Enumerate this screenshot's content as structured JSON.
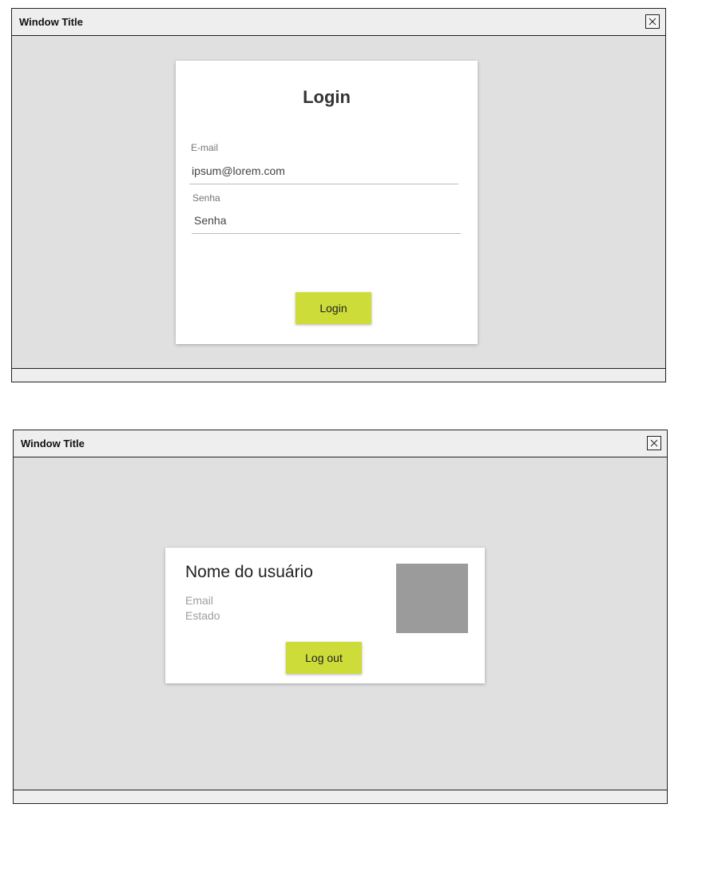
{
  "login_window": {
    "title": "Window Title",
    "card": {
      "heading": "Login",
      "email_label": "E-mail",
      "email_value": "ipsum@lorem.com",
      "password_label": "Senha",
      "password_placeholder": "Senha",
      "login_button": "Login"
    }
  },
  "profile_window": {
    "title": "Window Title",
    "card": {
      "user_name": "Nome do usuário",
      "email": "Email",
      "state": "Estado",
      "logout_button": "Log out"
    }
  },
  "icons": {
    "close": "close-icon"
  },
  "colors": {
    "accent_button": "#cddc39",
    "avatar_placeholder": "#9b9b9b",
    "window_background": "#e0e0e0"
  }
}
